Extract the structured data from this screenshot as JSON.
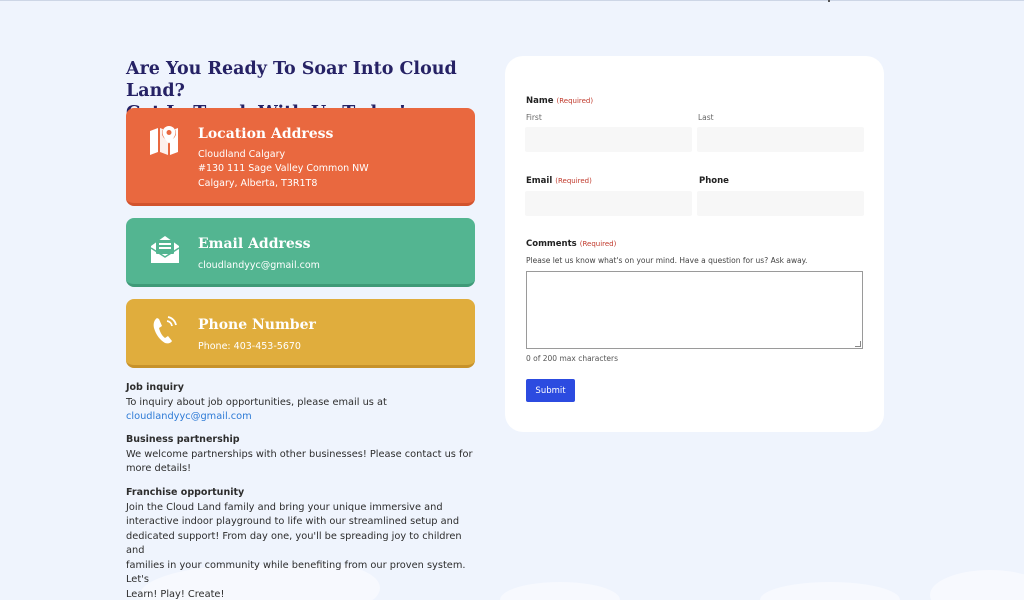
{
  "heading": {
    "line1": "Are You Ready To Soar Into Cloud Land?",
    "line2": "Get In Touch With Us Today!"
  },
  "cards": {
    "location": {
      "icon": "map-pin-icon",
      "title": "Location Address",
      "line1": "Cloudland Calgary",
      "line2": "#130 111 Sage Valley Common NW",
      "line3": "Calgary, Alberta, T3R1T8",
      "color": "#e9683f"
    },
    "email": {
      "icon": "envelope-icon",
      "title": "Email Address",
      "line1": "cloudlandyyc@gmail.com",
      "color": "#53b591"
    },
    "phone": {
      "icon": "phone-icon",
      "title": "Phone Number",
      "line1": "Phone: 403-453-5670",
      "color": "#e0ad3d"
    }
  },
  "info": {
    "job": {
      "title": "Job inquiry",
      "text": "To inquiry about job opportunities, please email us at",
      "link": "cloudlandyyc@gmail.com"
    },
    "business": {
      "title": "Business partnership",
      "line1": "We welcome partnerships with other businesses! Please contact us for",
      "line2": "more details!"
    },
    "franchise": {
      "title": "Franchise opportunity",
      "line1": "Join the Cloud Land family and bring your unique immersive and",
      "line2": "interactive indoor playground to life with our streamlined setup and",
      "line3": "dedicated support! From day one, you'll be spreading joy to children and",
      "line4": "families in your community while benefiting from our proven system. Let's",
      "line5": "Learn! Play! Create!"
    }
  },
  "form": {
    "name_label": "Name",
    "required": "(Required)",
    "first_label": "First",
    "last_label": "Last",
    "first_value": "",
    "last_value": "",
    "email_label": "Email",
    "email_value": "",
    "phone_label": "Phone",
    "phone_value": "",
    "comments_label": "Comments",
    "comments_hint": "Please let us know what's on your mind. Have a question for us? Ask away.",
    "comments_value": "",
    "char_count": "0 of 200 max characters",
    "submit_label": "Submit",
    "submit_color": "#2c4be0"
  }
}
